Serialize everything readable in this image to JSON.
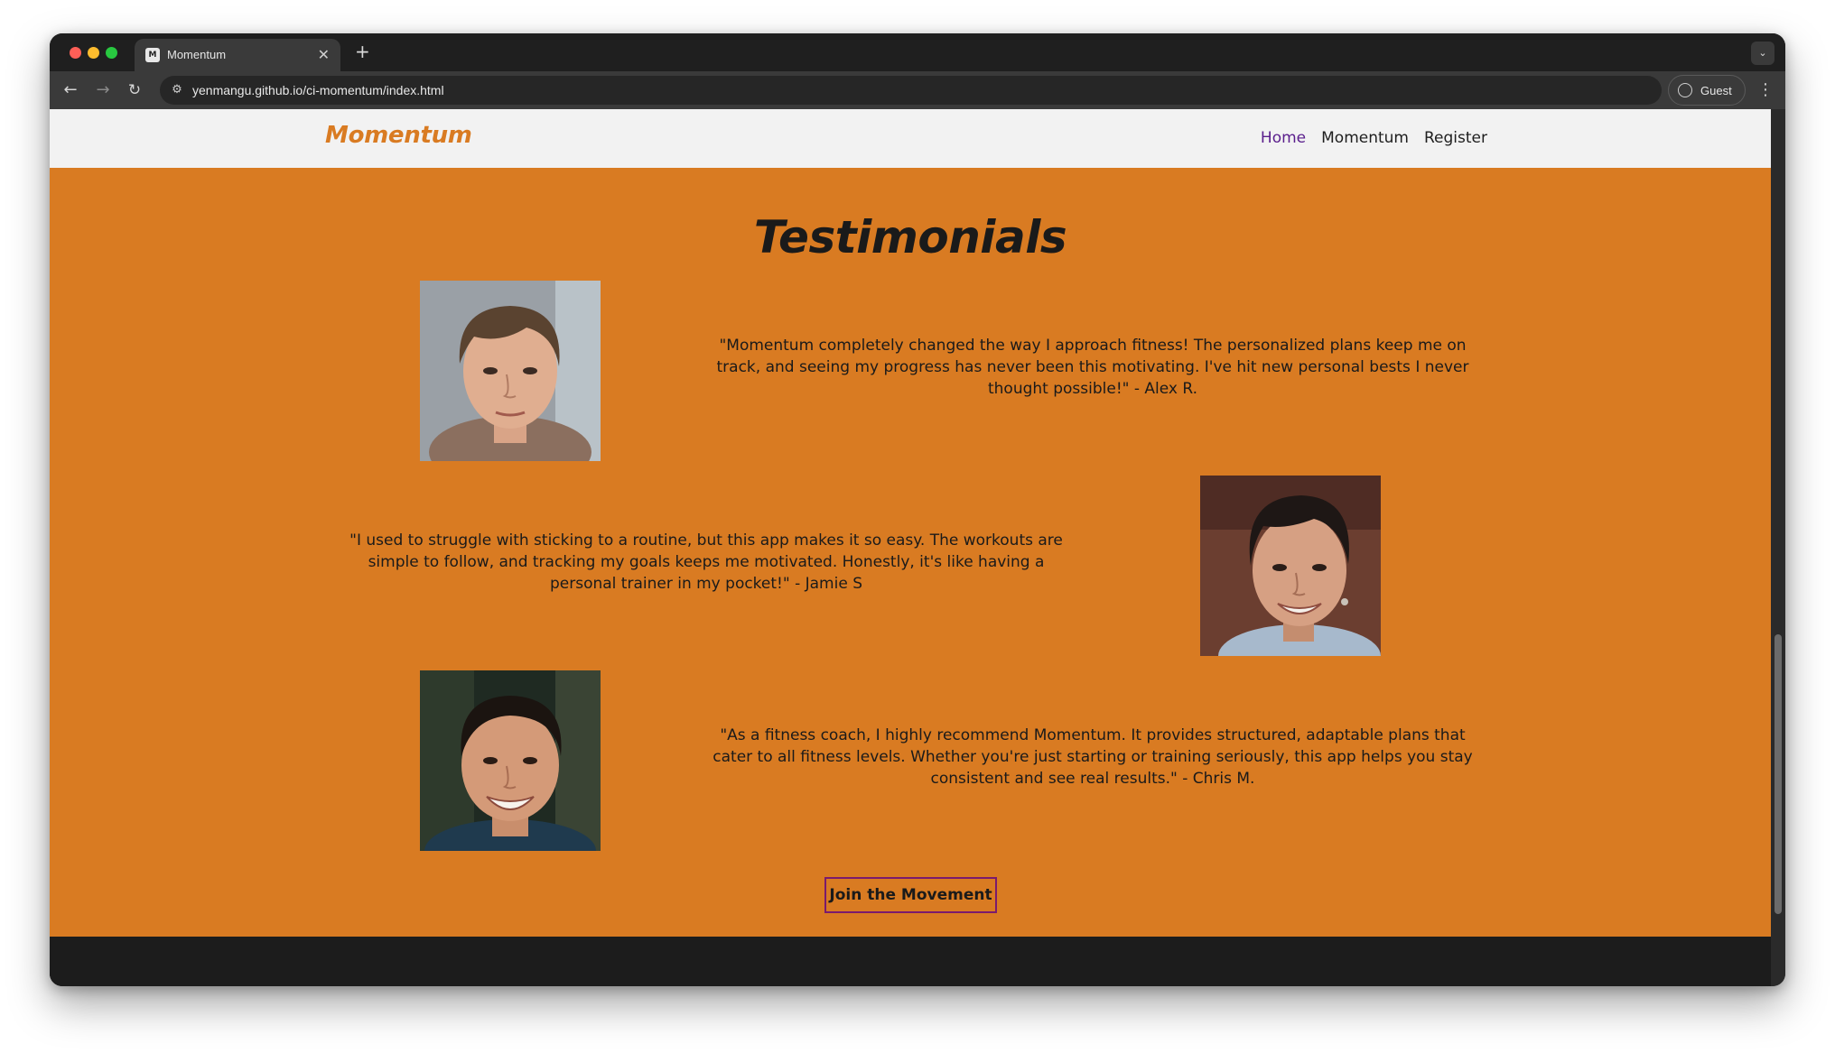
{
  "browser": {
    "tab_title": "Momentum",
    "tab_favicon": "M",
    "url": "yenmangu.github.io/ci-momentum/index.html",
    "profile_label": "Guest",
    "icons": {
      "back": "arrow-left-icon",
      "forward": "arrow-right-icon",
      "reload": "reload-icon",
      "site_info": "tune-icon",
      "profile": "person-circle-icon",
      "menu": "three-dots-icon",
      "new_tab": "plus-icon",
      "close_tab": "close-icon",
      "tab_list": "chevron-down-icon"
    }
  },
  "site": {
    "logo": "Momentum",
    "nav": [
      {
        "label": "Home",
        "active": true
      },
      {
        "label": "Momentum",
        "active": false
      },
      {
        "label": "Register",
        "active": false
      }
    ]
  },
  "testimonials": {
    "title": "Testimonials",
    "items": [
      {
        "quote": "\"Momentum completely changed the way I approach fitness! The personalized plans keep me on track, and seeing my progress has never been this motivating. I've hit new personal bests I never thought possible!\" - Alex R."
      },
      {
        "quote": "\"I used to struggle with sticking to a routine, but this app makes it so easy. The workouts are simple to follow, and tracking my goals keeps me motivated. Honestly, it's like having a personal trainer in my pocket!\" - Jamie S"
      },
      {
        "quote": "\"As a fitness coach, I highly recommend Momentum. It provides structured, adaptable plans that cater to all fitness levels. Whether you're just starting or training seriously, this app helps you stay consistent and see real results.\" - Chris M."
      }
    ],
    "cta_label": "Join the Movement"
  },
  "colors": {
    "brand_orange": "#d97b22",
    "nav_active": "#5a1e8c",
    "cta_border": "#7a1a6e",
    "header_bg": "#f2f2f2",
    "footer_bg": "#1c1c1c"
  }
}
